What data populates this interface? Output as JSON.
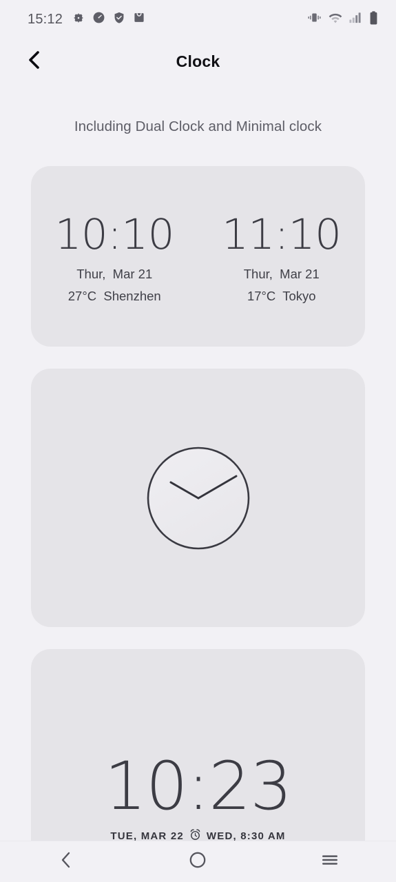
{
  "status_bar": {
    "time": "15:12",
    "left_icons": [
      "gear-icon",
      "speedometer-icon",
      "shield-check-icon",
      "shopping-bag-icon"
    ],
    "right_icons": [
      "vibrate-icon",
      "wifi-icon",
      "signal-bars-icon",
      "battery-icon"
    ]
  },
  "app_bar": {
    "back_icon": "chevron-left-icon",
    "title": "Clock"
  },
  "subtitle": "Including Dual Clock and Minimal clock",
  "cards": {
    "dual_clock": {
      "left": {
        "time": "10:10",
        "date": "Thur,  Mar 21",
        "weather": "27°C  Shenzhen"
      },
      "right": {
        "time": "11:10",
        "date": "Thur,  Mar 21",
        "weather": "17°C  Tokyo"
      }
    },
    "minimal_clock": {
      "icon": "analog-clock-face",
      "hour_angle": -60,
      "minute_angle": 60
    },
    "digital_clock": {
      "time": "10:23",
      "date": "TUE, MAR 22",
      "alarm_icon": "alarm-clock-icon",
      "alarm_text": "WED, 8:30 AM"
    }
  },
  "nav_bar": {
    "back": "chevron-left-icon",
    "home": "circle-icon",
    "recents": "menu-lines-icon"
  },
  "colors": {
    "page_bg": "#f2f1f5",
    "card_bg": "#e5e4e8",
    "text_primary": "#3c3c44",
    "text_secondary": "#5d5d66",
    "title": "#101014",
    "icon_gray": "#6b6b74"
  }
}
